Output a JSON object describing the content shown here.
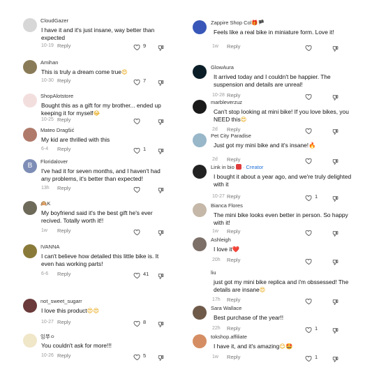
{
  "left": [
    {
      "user": "CloudGazer",
      "text": "I have it and it's just insane, way better than expected",
      "date": "10-19",
      "reply": "Reply",
      "likes": "9"
    },
    {
      "user": "Amihan",
      "text": "This is truly a dream come true",
      "emoji": "😍",
      "date": "10-30",
      "reply": "Reply",
      "likes": "7"
    },
    {
      "user": "ShopAlotstore",
      "text": "Bought this as a gift for my brother... ended up keeping it for myself",
      "emoji": "😂",
      "date": "10-25",
      "reply": "Reply",
      "likes": ""
    },
    {
      "user": "Mateo Dragšić",
      "text": "My kid are thrilled with this",
      "date": "6-4",
      "reply": "Reply",
      "likes": "1"
    },
    {
      "user": "Floridalover",
      "text": "I've had it for seven months, and I haven't had any problems, it's better than expected!",
      "date": "13h",
      "reply": "Reply",
      "likes": ""
    },
    {
      "user": "K",
      "user_prefix": "🙉",
      "text": "My boyfriend said it's the best gift he's ever recived. Totally worth it!!",
      "date": "1w",
      "reply": "Reply",
      "likes": ""
    },
    {
      "user": "IVANNA",
      "text": "I can't believe how detailed this little bike is. It even has working parts!",
      "date": "6-6",
      "reply": "Reply",
      "likes": "41"
    },
    {
      "user": "not_sweet_sugarr",
      "text": "I love this product",
      "emoji": "😍😍",
      "date": "10-27",
      "reply": "Reply",
      "likes": "8"
    },
    {
      "user": "잉쭈ㅇ",
      "text": "You couldn't ask for more!!!",
      "date": "10-26",
      "reply": "Reply",
      "likes": "5"
    }
  ],
  "right": [
    {
      "user": "Zappire Shop Col",
      "user_suffix": "🎁🏴",
      "text": "Feels like a real bike in miniature form. Love it!",
      "date": "1w",
      "reply": "Reply",
      "likes": ""
    },
    {
      "user": "GlowAura",
      "text": "It arrived today and I couldn't be happier. The suspension and details are unreal!",
      "date": "10-28",
      "reply": "Reply",
      "likes": ""
    },
    {
      "user": "marbleverzuz",
      "text": "Can't stop looking at mini bike! If you love bikes, you NEED this",
      "emoji": "😍",
      "date": "2d",
      "reply": "Reply",
      "likes": ""
    },
    {
      "user": "Pet City Paradise",
      "text": "Just got my mini bike and it's insane!",
      "emoji": "🔥",
      "date": "2d",
      "reply": "Reply",
      "likes": ""
    },
    {
      "user": "Link in bio",
      "creator": "· Creator",
      "text": "I bought it about a year ago, and we're truly delighted with it",
      "date": "10-27",
      "reply": "Reply",
      "likes": "1"
    },
    {
      "user": "Bianca Flores",
      "text": "The mini bike looks even better in person. So happy with it!",
      "date": "1w",
      "reply": "Reply",
      "likes": ""
    },
    {
      "user": "Ashleigh",
      "text": "I love it",
      "emoji": "❤️",
      "date": "20h",
      "reply": "Reply",
      "likes": ""
    },
    {
      "user": "liu",
      "text": "just got my mini bike replica and i'm obssessed! The details are insane",
      "emoji": "😍",
      "date": "17h",
      "reply": "Reply",
      "likes": ""
    },
    {
      "user": "Sara Wallace",
      "text": "Best purchase of the year!!",
      "date": "22h",
      "reply": "Reply",
      "likes": "1"
    },
    {
      "user": "tokshop.affiliate",
      "text": "I have it, and it's amazing",
      "emoji": "😊🤩",
      "date": "1w",
      "reply": "Reply",
      "likes": "1"
    }
  ],
  "colors": {
    "text": "#111111",
    "meta": "#9a9a9a",
    "creator": "#1f6fd6"
  },
  "icons": [
    "heart-icon",
    "dislike-icon",
    "avatar"
  ]
}
